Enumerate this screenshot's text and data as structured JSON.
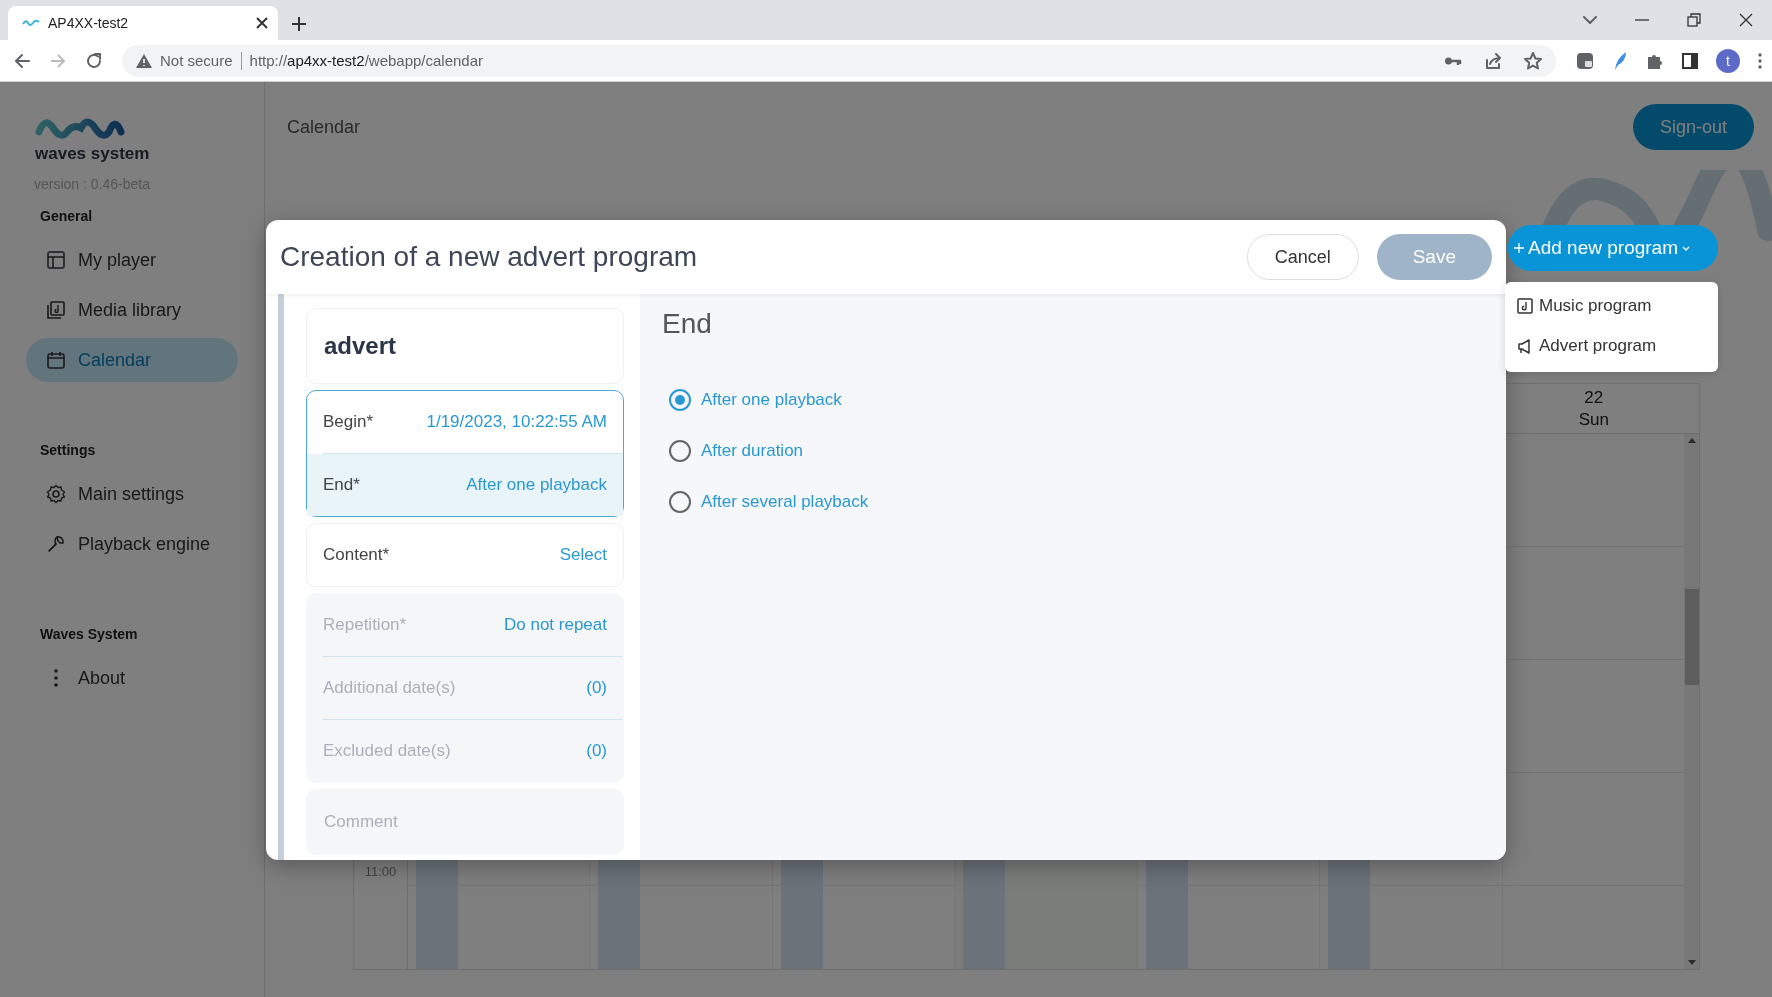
{
  "browser": {
    "tab": {
      "title": "AP4XX-test2",
      "selected": true
    },
    "address": {
      "security": "Not secure",
      "url": "http://**ap4xx-test2**/webapp/calendar"
    },
    "profile": "t"
  },
  "sidebar": {
    "brand": "waves system",
    "version": "version : 0.46-beta",
    "sections": [
      {
        "title": "General",
        "items": [
          {
            "label": "My player",
            "selected": false
          },
          {
            "label": "Media library",
            "selected": false
          },
          {
            "label": "Calendar",
            "selected": true
          }
        ]
      },
      {
        "title": "Settings",
        "items": [
          {
            "label": "Main settings",
            "selected": false
          },
          {
            "label": "Playback engine",
            "selected": false
          }
        ]
      },
      {
        "title": "Waves System",
        "items": [
          {
            "label": "About",
            "selected": false
          }
        ]
      }
    ]
  },
  "header": {
    "title": "Calendar",
    "sign_out": "Sign-out"
  },
  "add_program": {
    "label": "Add new program",
    "menu": [
      "Music program",
      "Advert program"
    ]
  },
  "calendar": {
    "days": [
      {
        "date": "22",
        "weekday": "Sun"
      }
    ],
    "times": [
      "11:00"
    ]
  },
  "modal": {
    "title": "Creation of a new advert program",
    "cancel": "Cancel",
    "save": {
      "label": "Save",
      "disabled": true
    },
    "name": "advert",
    "groups": [
      {
        "focused": true,
        "disabled": false,
        "rows": [
          {
            "label": "Begin*",
            "value": "1/19/2023, 10:22:55 AM",
            "selected": false
          },
          {
            "label": "End*",
            "value": "After one playback",
            "selected": true
          }
        ]
      },
      {
        "focused": false,
        "disabled": false,
        "rows": [
          {
            "label": "Content*",
            "value": "Select",
            "selected": false
          }
        ]
      },
      {
        "focused": false,
        "disabled": true,
        "rows": [
          {
            "label": "Repetition*",
            "value": "Do not repeat",
            "selected": false
          },
          {
            "label": "Additional date(s)",
            "value": "(0)",
            "selected": false
          },
          {
            "label": "Excluded date(s)",
            "value": "(0)",
            "selected": false
          }
        ]
      }
    ],
    "comment": {
      "placeholder": "Comment"
    },
    "end": {
      "title": "End",
      "options": [
        {
          "label": "After one playback",
          "selected": true
        },
        {
          "label": "After duration",
          "selected": false
        },
        {
          "label": "After several playback",
          "selected": false
        }
      ]
    }
  }
}
